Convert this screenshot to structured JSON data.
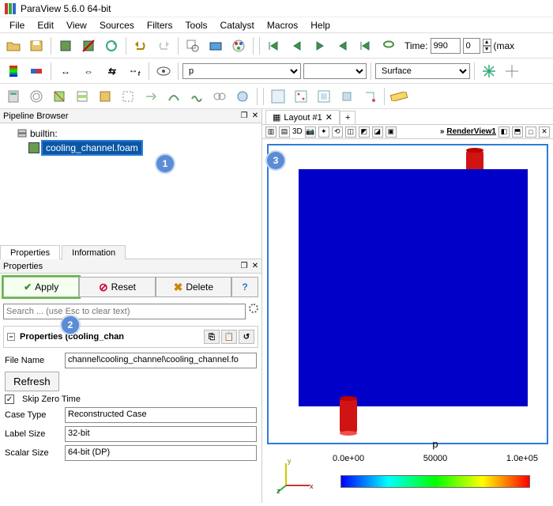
{
  "window": {
    "title": "ParaView 5.6.0 64-bit"
  },
  "menu": [
    "File",
    "Edit",
    "View",
    "Sources",
    "Filters",
    "Tools",
    "Catalyst",
    "Macros",
    "Help"
  ],
  "time_controls": {
    "label": "Time:",
    "time_value": "990",
    "frame_value": "0",
    "suffix": "(max"
  },
  "coloring": {
    "field": "p",
    "component": "",
    "representation": "Surface"
  },
  "pipeline": {
    "title": "Pipeline Browser",
    "server": "builtin:",
    "selected_item": "cooling_channel.foam"
  },
  "props_tabs": {
    "tab0": "Properties",
    "tab1": "Information"
  },
  "properties": {
    "panel_title": "Properties",
    "apply": "Apply",
    "reset": "Reset",
    "delete": "Delete",
    "help": "?",
    "search_placeholder": "Search ... (use Esc to clear text)",
    "section_title": "Properties (cooling_chan",
    "file_name_label": "File Name",
    "file_name_value": "channel\\cooling_channel\\cooling_channel.fo",
    "refresh": "Refresh",
    "skip_zero_label": "Skip Zero Time",
    "skip_zero_checked": "✓",
    "case_type_label": "Case Type",
    "case_type_value": "Reconstructed Case",
    "label_size_label": "Label Size",
    "label_size_value": "32-bit",
    "scalar_size_label": "Scalar Size",
    "scalar_size_value": "64-bit (DP)"
  },
  "layout": {
    "tab_label": "Layout #1",
    "add": "+",
    "view3d": "3D",
    "render_view_label": "RenderView1"
  },
  "legend": {
    "title": "p",
    "t0": "0.0e+00",
    "t1": "50000",
    "t2": "1.0e+05"
  },
  "axes": {
    "x": "x",
    "y": "y",
    "z": "z"
  },
  "annotations": {
    "a1": "1",
    "a2": "2",
    "a3": "3"
  },
  "chart_data": {
    "type": "heatmap",
    "title": "p",
    "colormap": "rainbow (blue→red)",
    "range": [
      0,
      100000
    ],
    "ticks": [
      0,
      50000,
      100000
    ]
  }
}
